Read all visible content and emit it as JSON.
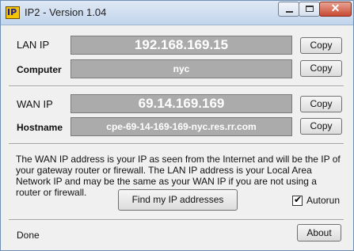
{
  "window": {
    "title": "IP2 - Version 1.04",
    "icon_text": "IP"
  },
  "lan": {
    "label": "LAN IP",
    "value": "192.168.169.15",
    "copy": "Copy"
  },
  "computer": {
    "label": "Computer",
    "value": "nyc",
    "copy": "Copy"
  },
  "wan": {
    "label": "WAN IP",
    "value": "69.14.169.169",
    "copy": "Copy"
  },
  "hostname": {
    "label": "Hostname",
    "value": "cpe-69-14-169-169-nyc.res.rr.com",
    "copy": "Copy"
  },
  "description": "The WAN IP address is your IP as seen from the Internet and will be the IP of your gateway router or firewall. The LAN IP address is your Local Area Network IP and may be the same as your WAN IP if you are not using a router or firewall.",
  "find_button": "Find my IP addresses",
  "autorun": {
    "label": "Autorun",
    "checked": true
  },
  "status": "Done",
  "about_button": "About"
}
